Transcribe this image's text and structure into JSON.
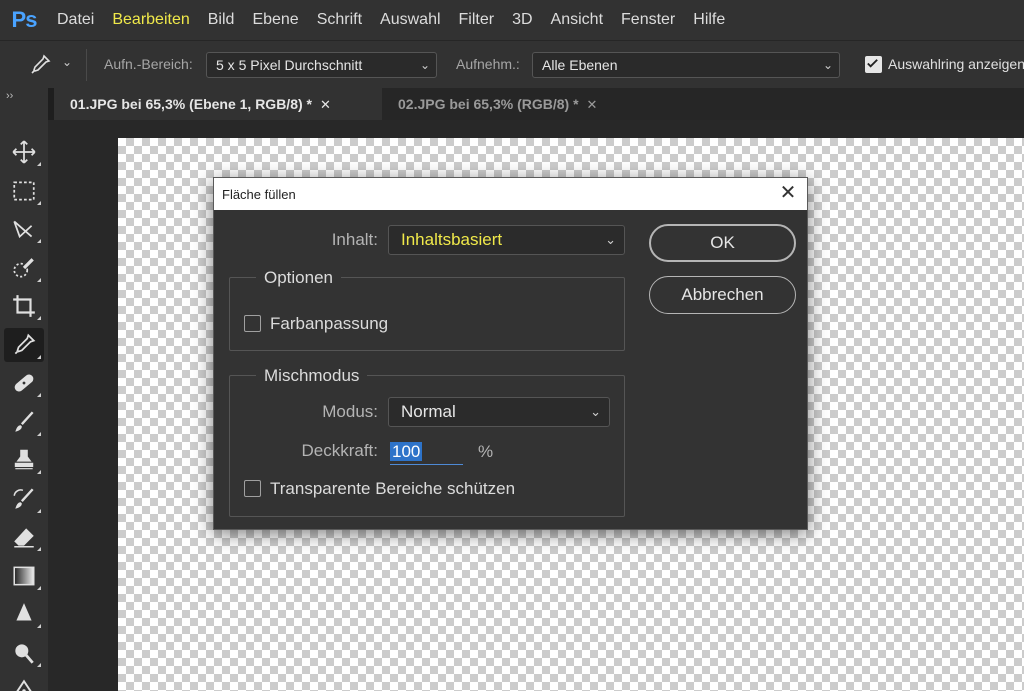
{
  "app": {
    "logo": "Ps",
    "accent_color": "#4aa3ff",
    "highlight_color": "#f0e94a"
  },
  "menubar": {
    "items": [
      {
        "label": "Datei",
        "highlighted": false
      },
      {
        "label": "Bearbeiten",
        "highlighted": true
      },
      {
        "label": "Bild",
        "highlighted": false
      },
      {
        "label": "Ebene",
        "highlighted": false
      },
      {
        "label": "Schrift",
        "highlighted": false
      },
      {
        "label": "Auswahl",
        "highlighted": false
      },
      {
        "label": "Filter",
        "highlighted": false
      },
      {
        "label": "3D",
        "highlighted": false
      },
      {
        "label": "Ansicht",
        "highlighted": false
      },
      {
        "label": "Fenster",
        "highlighted": false
      },
      {
        "label": "Hilfe",
        "highlighted": false
      }
    ]
  },
  "options_bar": {
    "tool_icon": "eyedropper-icon",
    "sample_size_label": "Aufn.-Bereich:",
    "sample_size_value": "5 x 5 Pixel Durchschnitt",
    "sample_label": "Aufnehm.:",
    "sample_value": "Alle Ebenen",
    "show_ring_label": "Auswahlring anzeigen",
    "show_ring_checked": true
  },
  "tabs": [
    {
      "label": "01.JPG bei 65,3% (Ebene 1, RGB/8) *",
      "active": true,
      "close": "✕"
    },
    {
      "label": "02.JPG bei 65,3% (RGB/8) *",
      "active": false,
      "close": "✕"
    }
  ],
  "toolbar": {
    "collapse": "››",
    "tools": [
      {
        "name": "move-tool-icon",
        "active": false
      },
      {
        "name": "marquee-tool-icon",
        "active": false
      },
      {
        "name": "lasso-tool-icon",
        "active": false
      },
      {
        "name": "quick-selection-tool-icon",
        "active": false
      },
      {
        "name": "crop-tool-icon",
        "active": false
      },
      {
        "name": "eyedropper-tool-icon",
        "active": true
      },
      {
        "name": "healing-brush-tool-icon",
        "active": false
      },
      {
        "name": "brush-tool-icon",
        "active": false
      },
      {
        "name": "clone-stamp-tool-icon",
        "active": false
      },
      {
        "name": "history-brush-tool-icon",
        "active": false
      },
      {
        "name": "eraser-tool-icon",
        "active": false
      },
      {
        "name": "gradient-tool-icon",
        "active": false
      },
      {
        "name": "blur-tool-icon",
        "active": false
      },
      {
        "name": "dodge-tool-icon",
        "active": false
      },
      {
        "name": "pen-tool-icon",
        "active": false
      }
    ]
  },
  "dialog": {
    "title": "Fläche füllen",
    "close": "✕",
    "content_label": "Inhalt:",
    "content_value": "Inhaltsbasiert",
    "options_legend": "Optionen",
    "color_adaptation_label": "Farbanpassung",
    "color_adaptation_checked": false,
    "blending_legend": "Mischmodus",
    "mode_label": "Modus:",
    "mode_value": "Normal",
    "opacity_label": "Deckkraft:",
    "opacity_value": "100",
    "opacity_unit": "%",
    "preserve_transparency_label": "Transparente Bereiche schützen",
    "preserve_transparency_checked": false,
    "ok_label": "OK",
    "cancel_label": "Abbrechen"
  }
}
